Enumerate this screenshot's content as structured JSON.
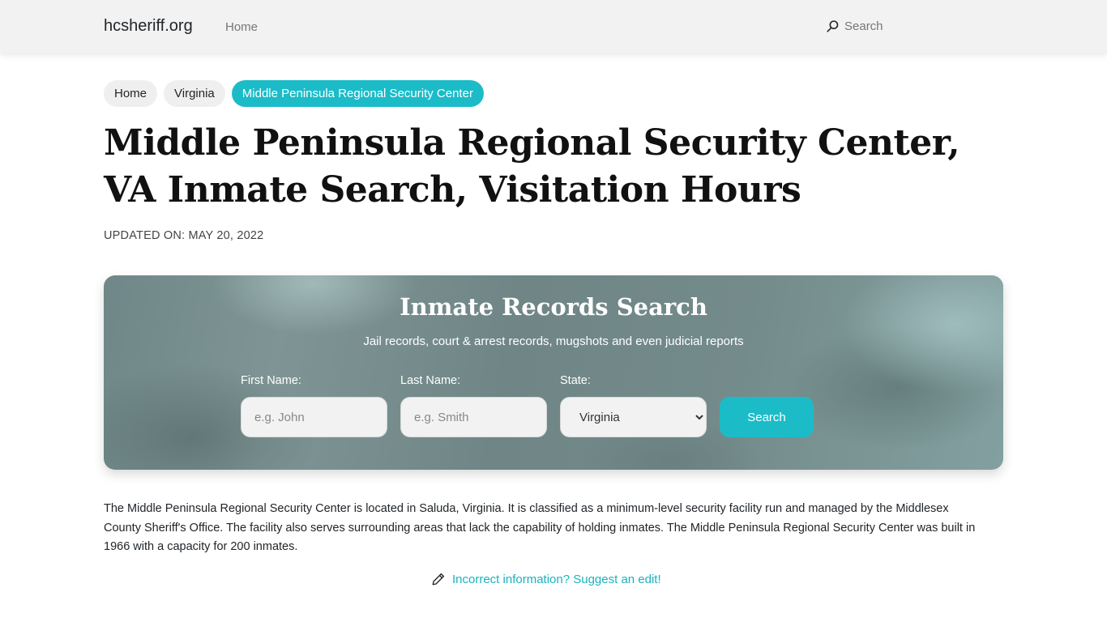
{
  "navbar": {
    "brand": "hcsheriff.org",
    "home_link": "Home",
    "search_label": "Search",
    "search_icon": "search-icon"
  },
  "breadcrumb": [
    {
      "label": "Home",
      "active": false
    },
    {
      "label": "Virginia",
      "active": false
    },
    {
      "label": "Middle Peninsula Regional Security Center",
      "active": true
    }
  ],
  "page": {
    "title": "Middle Peninsula Regional Security Center, VA Inmate Search, Visitation Hours",
    "updated": "UPDATED ON: MAY 20, 2022"
  },
  "search_card": {
    "title": "Inmate Records Search",
    "subtitle": "Jail records, court & arrest records, mugshots and even judicial reports",
    "first_name": {
      "label": "First Name:",
      "placeholder": "e.g. John",
      "value": ""
    },
    "last_name": {
      "label": "Last Name:",
      "placeholder": "e.g. Smith",
      "value": ""
    },
    "state": {
      "label": "State:",
      "selected": "Virginia"
    },
    "search_button": "Search"
  },
  "description": "The Middle Peninsula Regional Security Center is located in Saluda, Virginia. It is classified as a minimum-level security facility run and managed by the Middlesex County Sheriff's Office. The facility also serves surrounding areas that lack the capability of holding inmates. The Middle Peninsula Regional Security Center was built in 1966 with a capacity for 200 inmates.",
  "suggest_edit": {
    "icon": "pencil-icon",
    "label": "Incorrect information? Suggest an edit!"
  },
  "colors": {
    "accent": "#1bbcc8",
    "navbar_bg": "#f2f2f2",
    "link": "#1bb2be"
  }
}
